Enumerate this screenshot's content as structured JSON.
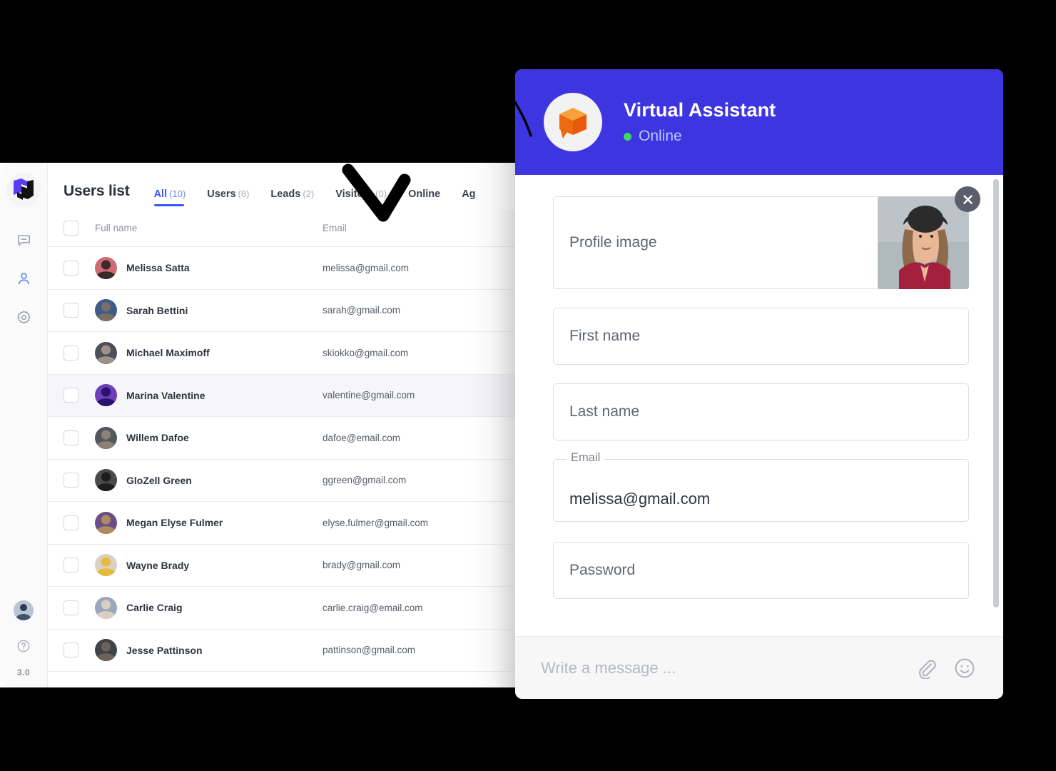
{
  "colors": {
    "accent_blue": "#3857f0",
    "chat_header_blue": "#3d36e0",
    "status_green": "#3ddb5f",
    "logo_orange": "#f07818",
    "logo_purple": "#5b3df0"
  },
  "sidebar": {
    "logo_icon": "cube-logo-icon",
    "items": [
      {
        "icon": "chat-bubble-icon",
        "name": "sidebar-item-chats",
        "active": false
      },
      {
        "icon": "user-icon",
        "name": "sidebar-item-users",
        "active": true
      },
      {
        "icon": "gear-icon",
        "name": "sidebar-item-settings",
        "active": false
      }
    ],
    "avatar_icon": "account-avatar",
    "help_icon": "help-circle-icon",
    "version": "3.0"
  },
  "app": {
    "page_title": "Users list",
    "tabs": [
      {
        "label": "All",
        "count": "(10)",
        "active": true
      },
      {
        "label": "Users",
        "count": "(8)",
        "active": false
      },
      {
        "label": "Leads",
        "count": "(2)",
        "active": false
      },
      {
        "label": "Visitors",
        "count": "(0)",
        "active": false
      },
      {
        "label": "Online",
        "count": "",
        "active": false
      },
      {
        "label": "Ag",
        "count": "",
        "active": false
      }
    ],
    "table": {
      "headers": {
        "full_name": "Full name",
        "email": "Email"
      },
      "rows": [
        {
          "name": "Melissa Satta",
          "email": "melissa@gmail.com",
          "highlight": false,
          "av1": "#3a2a2a",
          "av2": "#d06a74"
        },
        {
          "name": "Sarah Bettini",
          "email": "sarah@gmail.com",
          "highlight": false,
          "av1": "#7b6f63",
          "av2": "#3f5b8a"
        },
        {
          "name": "Michael Maximoff",
          "email": "skiokko@gmail.com",
          "highlight": false,
          "av1": "#9c9287",
          "av2": "#4b4f57"
        },
        {
          "name": "Marina Valentine",
          "email": "valentine@gmail.com",
          "highlight": true,
          "av1": "#2d1170",
          "av2": "#6d3fb8"
        },
        {
          "name": "Willem Dafoe",
          "email": "dafoe@email.com",
          "highlight": false,
          "av1": "#8b8175",
          "av2": "#53585f"
        },
        {
          "name": "GloZell Green",
          "email": "ggreen@gmail.com",
          "highlight": false,
          "av1": "#1d1d1d",
          "av2": "#4a4a4a"
        },
        {
          "name": "Megan Elyse Fulmer",
          "email": "elyse.fulmer@gmail.com",
          "highlight": false,
          "av1": "#b08a5e",
          "av2": "#6a4f86"
        },
        {
          "name": "Wayne Brady",
          "email": "brady@gmail.com",
          "highlight": false,
          "av1": "#e7b93c",
          "av2": "#d8d2c4"
        },
        {
          "name": "Carlie Craig",
          "email": "carlie.craig@email.com",
          "highlight": false,
          "av1": "#d9cfc0",
          "av2": "#9aa7bb"
        },
        {
          "name": "Jesse Pattinson",
          "email": "pattinson@gmail.com",
          "highlight": false,
          "av1": "#6e6257",
          "av2": "#3e434a"
        }
      ]
    }
  },
  "chat": {
    "bot_logo_icon": "orange-cube-chat-icon",
    "title": "Virtual Assistant",
    "status": "Online",
    "form": {
      "profile_image_label": "Profile image",
      "profile_close_icon": "close-icon",
      "first_name_placeholder": "First name",
      "last_name_placeholder": "Last name",
      "email_label": "Email",
      "email_value": "melissa@gmail.com",
      "password_placeholder": "Password"
    },
    "footer": {
      "message_placeholder": "Write a message ...",
      "attach_icon": "paperclip-icon",
      "emoji_icon": "smiley-icon"
    }
  }
}
